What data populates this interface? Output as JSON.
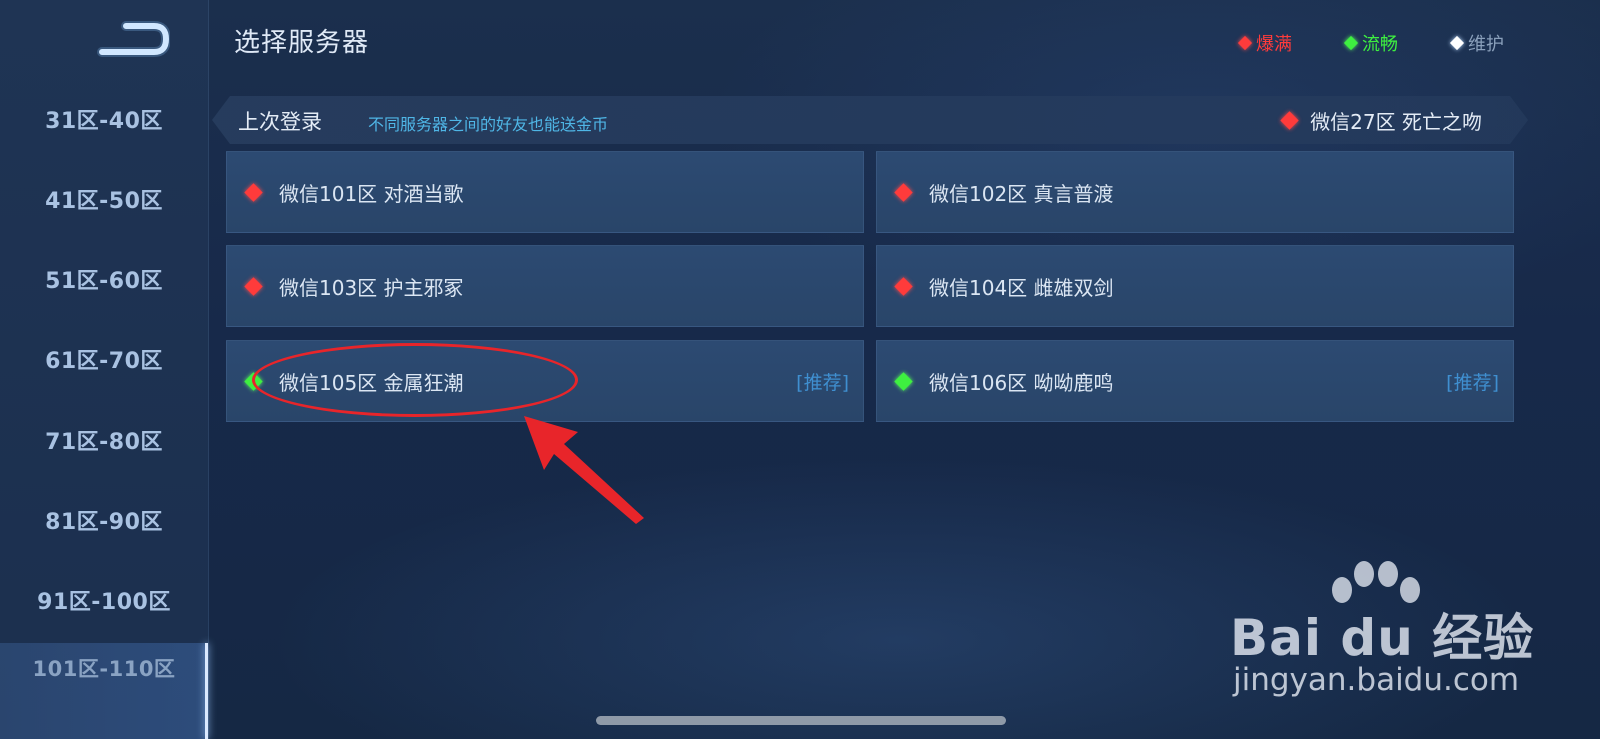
{
  "header": {
    "title": "选择服务器",
    "legend": [
      {
        "label": "爆满",
        "color": "#ff3b3b"
      },
      {
        "label": "流畅",
        "color": "#3ef040"
      },
      {
        "label": "维护",
        "color": "#ffffff"
      }
    ]
  },
  "sidebar": {
    "items": [
      {
        "label": "31区-40区"
      },
      {
        "label": "41区-50区"
      },
      {
        "label": "51区-60区"
      },
      {
        "label": "61区-70区"
      },
      {
        "label": "71区-80区"
      },
      {
        "label": "81区-90区"
      },
      {
        "label": "91区-100区"
      },
      {
        "label": "101区-110区"
      }
    ],
    "selected": "101区-110区"
  },
  "last_login": {
    "label": "上次登录",
    "tip": "不同服务器之间的好友也能送金币",
    "server": "微信27区 死亡之吻",
    "status": "爆满"
  },
  "servers": [
    {
      "name": "微信101区 对酒当歌",
      "status": "爆满",
      "tag": ""
    },
    {
      "name": "微信102区 真言普渡",
      "status": "爆满",
      "tag": ""
    },
    {
      "name": "微信103区 护主邪冢",
      "status": "爆满",
      "tag": ""
    },
    {
      "name": "微信104区 雌雄双剑",
      "status": "爆满",
      "tag": ""
    },
    {
      "name": "微信105区 金属狂潮",
      "status": "流畅",
      "tag": "[推荐]"
    },
    {
      "name": "微信106区 呦呦鹿鸣",
      "status": "流畅",
      "tag": "[推荐]"
    }
  ],
  "watermark": {
    "brand": "Bai du 经验",
    "url": "jingyan.baidu.com"
  },
  "icons": [
    "back-icon",
    "status-diamond-icon",
    "paw-icon",
    "annotation-arrow-icon"
  ]
}
